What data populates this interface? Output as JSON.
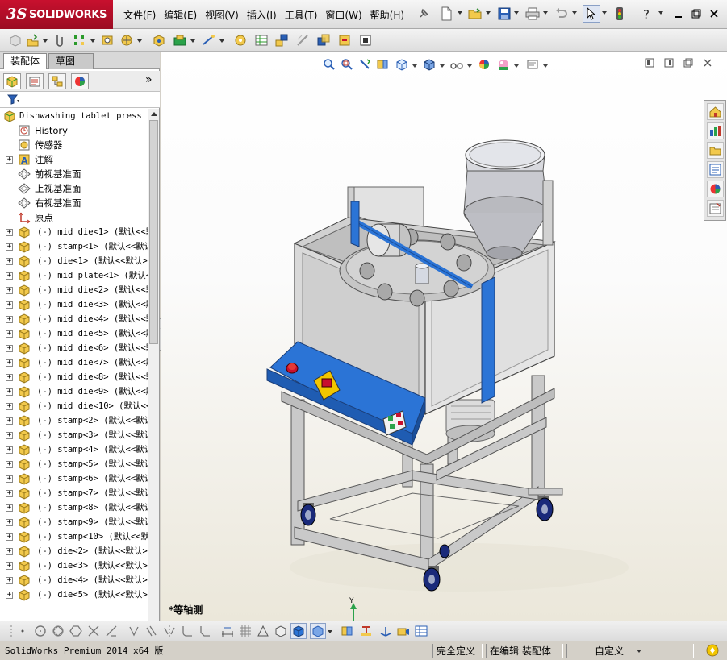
{
  "app": {
    "name": "SOLIDWORKS",
    "logo_ds": "3S",
    "menu": [
      "文件(F)",
      "编辑(E)",
      "视图(V)",
      "插入(I)",
      "工具(T)",
      "窗口(W)",
      "帮助(H)"
    ]
  },
  "left_panel": {
    "tabs": [
      "装配体",
      "草图"
    ],
    "panel_tools": [
      "feature-manager-icon",
      "property-manager-icon",
      "configuration-manager-icon",
      "display-manager-icon"
    ],
    "expand_label": "»",
    "root": "Dishwashing tablet press",
    "tree_leaves": [
      "History",
      "传感器",
      "注解",
      "前视基准面",
      "上视基准面",
      "右视基准面",
      "原点"
    ],
    "components": [
      {
        "state": "(-)",
        "name": "mid die<1>",
        "config": "(默认<<默"
      },
      {
        "state": "(-)",
        "name": "stamp<1>",
        "config": "(默认<<默认"
      },
      {
        "state": "(-)",
        "name": "die<1>",
        "config": "(默认<<默认>"
      },
      {
        "state": "(-)",
        "name": "mid plate<1>",
        "config": "(默认<"
      },
      {
        "state": "(-)",
        "name": "mid die<2>",
        "config": "(默认<<默"
      },
      {
        "state": "(-)",
        "name": "mid die<3>",
        "config": "(默认<<默"
      },
      {
        "state": "(-)",
        "name": "mid die<4>",
        "config": "(默认<<默"
      },
      {
        "state": "(-)",
        "name": "mid die<5>",
        "config": "(默认<<默"
      },
      {
        "state": "(-)",
        "name": "mid die<6>",
        "config": "(默认<<默"
      },
      {
        "state": "(-)",
        "name": "mid die<7>",
        "config": "(默认<<默"
      },
      {
        "state": "(-)",
        "name": "mid die<8>",
        "config": "(默认<<默"
      },
      {
        "state": "(-)",
        "name": "mid die<9>",
        "config": "(默认<<默"
      },
      {
        "state": "(-)",
        "name": "mid die<10>",
        "config": "(默认<<"
      },
      {
        "state": "(-)",
        "name": "stamp<2>",
        "config": "(默认<<默认"
      },
      {
        "state": "(-)",
        "name": "stamp<3>",
        "config": "(默认<<默认"
      },
      {
        "state": "(-)",
        "name": "stamp<4>",
        "config": "(默认<<默认"
      },
      {
        "state": "(-)",
        "name": "stamp<5>",
        "config": "(默认<<默认"
      },
      {
        "state": "(-)",
        "name": "stamp<6>",
        "config": "(默认<<默认"
      },
      {
        "state": "(-)",
        "name": "stamp<7>",
        "config": "(默认<<默认"
      },
      {
        "state": "(-)",
        "name": "stamp<8>",
        "config": "(默认<<默认"
      },
      {
        "state": "(-)",
        "name": "stamp<9>",
        "config": "(默认<<默认"
      },
      {
        "state": "(-)",
        "name": "stamp<10>",
        "config": "(默认<<默"
      },
      {
        "state": "(-)",
        "name": "die<2>",
        "config": "(默认<<默认>"
      },
      {
        "state": "(-)",
        "name": "die<3>",
        "config": "(默认<<默认>"
      },
      {
        "state": "(-)",
        "name": "die<4>",
        "config": "(默认<<默认>"
      },
      {
        "state": "(-)",
        "name": "die<5>",
        "config": "(默认<<默认>"
      }
    ]
  },
  "viewport": {
    "view_name": "*等轴测",
    "triad": {
      "x": "X",
      "y": "Y",
      "z": "Z"
    }
  },
  "status": {
    "product": "SolidWorks Premium 2014 x64 版",
    "defined": "完全定义",
    "editing": "在编辑 装配体",
    "units": "自定义"
  },
  "colors": {
    "sw_red": "#c8102e",
    "machine_blue": "#2b74d6",
    "panel_gray": "#d7d7d7",
    "frame_gray": "#c8c8c8"
  }
}
